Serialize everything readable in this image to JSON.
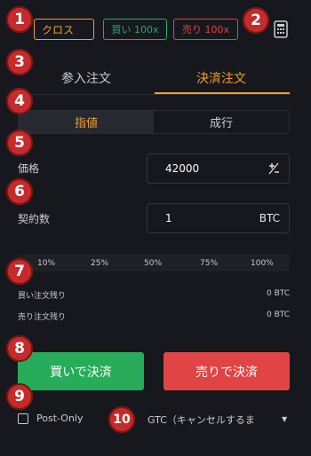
{
  "header": {
    "margin_mode": "クロス",
    "buy_leverage": "買い 100x",
    "sell_leverage": "売り 100x",
    "calculator_icon": "calculator-icon"
  },
  "tabs": [
    {
      "label": "参入注文",
      "active": false
    },
    {
      "label": "決済注文",
      "active": true
    }
  ],
  "order_type": [
    {
      "label": "指値",
      "active": true
    },
    {
      "label": "成行",
      "active": false
    }
  ],
  "price": {
    "label": "価格",
    "value": "42000",
    "icon": "plus-minus-icon"
  },
  "quantity": {
    "label": "契約数",
    "value": "1",
    "unit": "BTC"
  },
  "slider": {
    "marks": [
      "10%",
      "25%",
      "50%",
      "75%",
      "100%"
    ]
  },
  "remaining": [
    {
      "label": "買い注文残り",
      "value": "0 BTC"
    },
    {
      "label": "売り注文残り",
      "value": "0 BTC"
    }
  ],
  "actions": {
    "buy_close": "買いで決済",
    "sell_close": "売りで決済"
  },
  "options": {
    "post_only_label": "Post-Only",
    "post_only_checked": false,
    "time_in_force": "GTC（キャンセルするま",
    "dropdown_icon": "caret-down-icon"
  },
  "callouts": [
    "1",
    "2",
    "3",
    "4",
    "5",
    "6",
    "7",
    "8",
    "9",
    "10"
  ],
  "colors": {
    "background": "#16181e",
    "accent": "#f0a030",
    "buy": "#27ad5a",
    "sell": "#e04444",
    "callout": "#c62b2b"
  }
}
